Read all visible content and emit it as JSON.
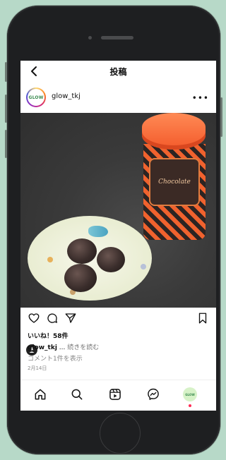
{
  "header": {
    "title": "投稿"
  },
  "profile": {
    "avatar_text": "GLOW",
    "username": "glow_tkj"
  },
  "post": {
    "tin_label": "Chocolate",
    "likes": "いいね！58件",
    "caption_user": "glow_tkj",
    "caption_ellipsis": " ... ",
    "caption_more": "続きを読む",
    "comments_link": "コメント1件を表示",
    "date": "2月14日"
  },
  "nav": {
    "avatar_text": "GLOW"
  },
  "icons": [
    "back-icon",
    "more-icon",
    "user-tag-icon",
    "heart-icon",
    "comment-icon",
    "share-icon",
    "bookmark-icon",
    "home-icon",
    "search-icon",
    "reels-icon",
    "messenger-icon",
    "profile-avatar"
  ],
  "colors": {
    "background": "#b7d9c8",
    "phone": "#1e1f21",
    "tin": "#f0622e"
  }
}
